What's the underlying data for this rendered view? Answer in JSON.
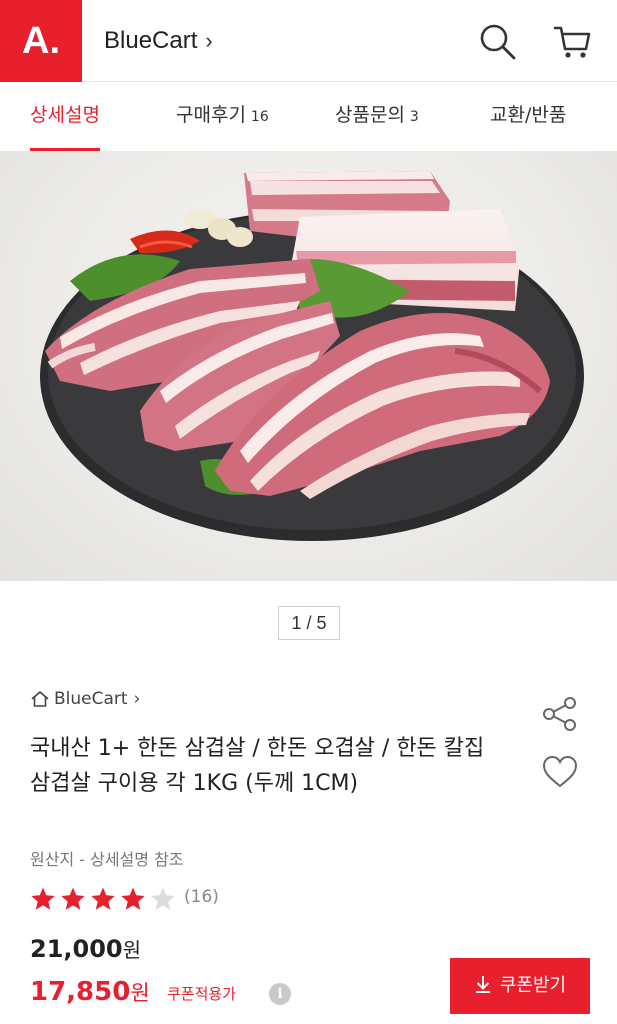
{
  "header": {
    "logo_text": "A.",
    "store_name": "BlueCart",
    "store_chevron": "›",
    "search_icon": "search-icon",
    "cart_icon": "cart-icon"
  },
  "tabs": [
    {
      "label": "상세설명",
      "count": "",
      "active": true
    },
    {
      "label": "구매후기",
      "count": "16",
      "active": false
    },
    {
      "label": "상품문의",
      "count": "3",
      "active": false
    },
    {
      "label": "교환/반품",
      "count": "",
      "active": false
    }
  ],
  "gallery": {
    "pager": "1 / 5",
    "image_alt": "pork-belly-on-slate-plate"
  },
  "product": {
    "brand": "BlueCart",
    "brand_chevron": "›",
    "title": "국내산 1+ 한돈 삼겹살 / 한돈 오겹살 / 한돈 칼집 삼겹살 구이용 각 1KG (두께 1CM)",
    "origin": "원산지 - 상세설명 참조",
    "rating": 4.5,
    "review_count": "(16)",
    "original_price": "21,000",
    "sale_price": "17,850",
    "currency": "원",
    "coupon_price_label": "쿠폰적용가",
    "info_icon_glyph": "i",
    "coupon_button": "쿠폰받기"
  },
  "colors": {
    "accent": "#e8202e",
    "star": "#e8202e",
    "text": "#222222"
  }
}
